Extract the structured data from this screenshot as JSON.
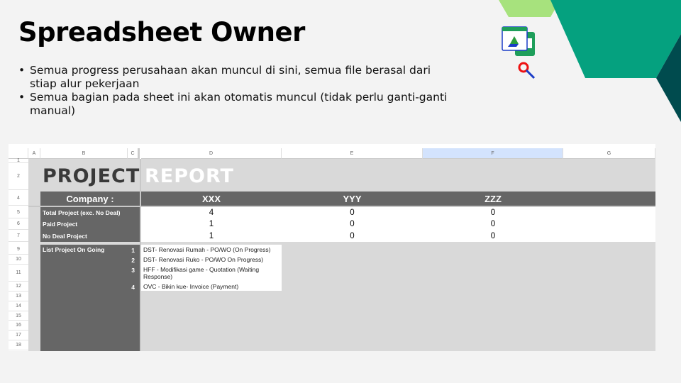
{
  "slide": {
    "title": "Spreadsheet Owner",
    "bullets": [
      "Semua progress perusahaan akan muncul di sini, semua file berasal dari stiap alur pekerjaan",
      "Semua bagian pada sheet ini akan otomatis muncul (tidak perlu ganti-ganti manual)"
    ]
  },
  "colors": {
    "teal": "#05a17f",
    "dark_teal": "#004b4e",
    "light_green": "#a7e27d",
    "sheet_dark": "#666666",
    "sheet_gray": "#d9d9d9"
  },
  "sheet": {
    "columns": [
      "A",
      "B",
      "C",
      "D",
      "E",
      "F",
      "G"
    ],
    "rows": [
      "1",
      "2",
      "4",
      "5",
      "6",
      "7",
      "9",
      "10",
      "11",
      "12",
      "13",
      "14",
      "15",
      "16",
      "17",
      "18"
    ],
    "title_dark": "PROJECT",
    "title_light": "REPORT",
    "company_label": "Company :",
    "companies": [
      "XXX",
      "YYY",
      "ZZZ"
    ],
    "metrics": [
      {
        "label": "Total Project (exc. No Deal)",
        "values": [
          "4",
          "0",
          "0"
        ]
      },
      {
        "label": "Paid Project",
        "values": [
          "1",
          "0",
          "0"
        ]
      },
      {
        "label": "No Deal Project",
        "values": [
          "1",
          "0",
          "0"
        ]
      }
    ],
    "list_label": "List Project On Going",
    "list": [
      {
        "n": "1",
        "text": "DST- Renovasi Rumah - PO/WO (On Progress)"
      },
      {
        "n": "2",
        "text": "DST- Renovasi Ruko - PO/WO On Progress)"
      },
      {
        "n": "3",
        "text": "HFF - Modifikasi game - Quotation (Waiting Response)"
      },
      {
        "n": "4",
        "text": "OVC - Bikin kue- Invoice (Payment)"
      }
    ]
  }
}
